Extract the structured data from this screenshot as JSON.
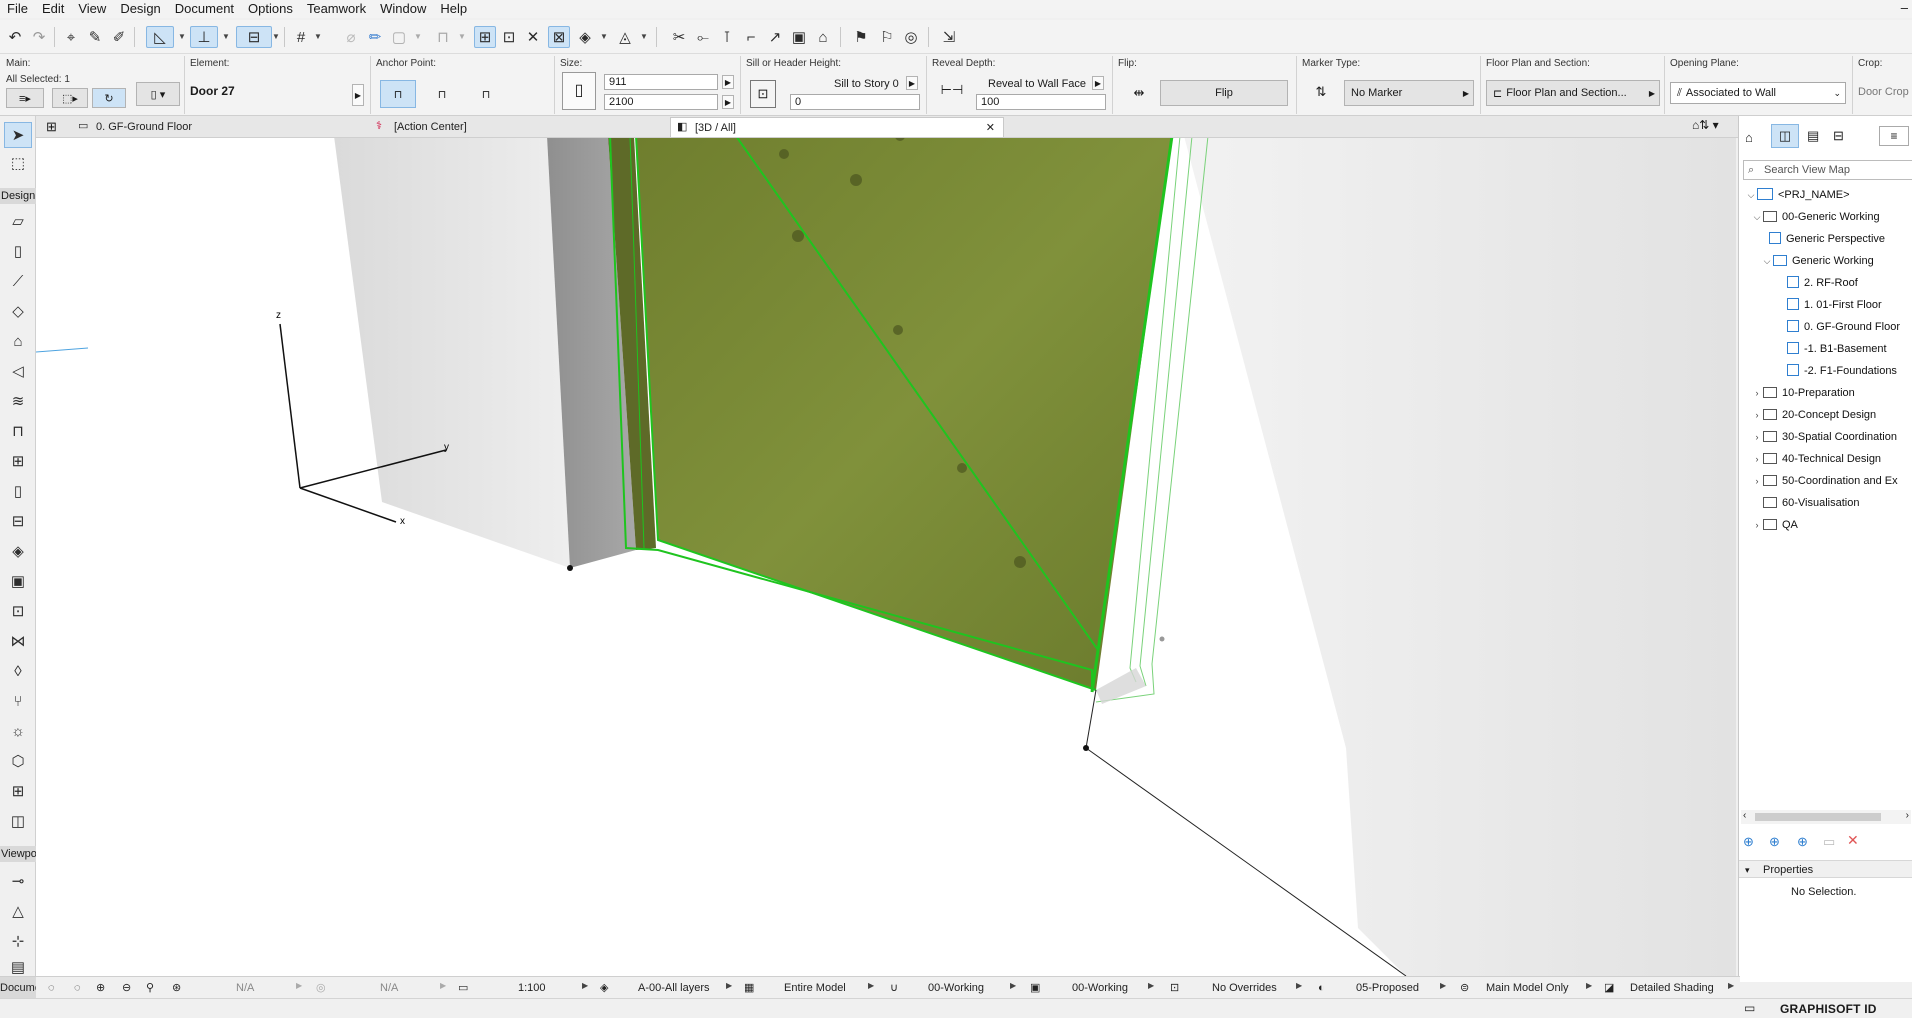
{
  "menu": [
    "File",
    "Edit",
    "View",
    "Design",
    "Document",
    "Options",
    "Teamwork",
    "Window",
    "Help"
  ],
  "infobox": {
    "main_label": "Main:",
    "all_selected": "All Selected: 1",
    "element_label": "Element:",
    "element_name": "Door 27",
    "anchor_label": "Anchor Point:",
    "size_label": "Size:",
    "width": "911",
    "height": "2100",
    "sill_label": "Sill or Header Height:",
    "sill_mode": "Sill to Story 0",
    "sill_value": "0",
    "reveal_label": "Reveal Depth:",
    "reveal_mode": "Reveal to Wall Face",
    "reveal_value": "100",
    "flip_label": "Flip:",
    "flip_button": "Flip",
    "marker_label": "Marker Type:",
    "marker_value": "No Marker",
    "fps_label": "Floor Plan and Section:",
    "fps_value": "Floor Plan and Section...",
    "opening_label": "Opening Plane:",
    "opening_value": "Associated to Wall",
    "crop_label": "Crop:",
    "crop_value": "Door Crop"
  },
  "tabs": [
    {
      "label": "0. GF-Ground Floor"
    },
    {
      "label": "[Action Center]"
    },
    {
      "label": "[3D / All]"
    }
  ],
  "toolbox": {
    "design_header": "Design",
    "viewpoint_header": "Viewpoi",
    "document_header": "Docume"
  },
  "axes": {
    "x": "x",
    "y": "y",
    "z": "z"
  },
  "navigator": {
    "search_placeholder": "Search View Map",
    "root": "<PRJ_NAME>",
    "items": [
      {
        "label": "00-Generic Working"
      },
      {
        "label": "Generic Perspective"
      },
      {
        "label": "Generic Working"
      },
      {
        "label": "2. RF-Roof"
      },
      {
        "label": "1. 01-First Floor"
      },
      {
        "label": "0. GF-Ground Floor"
      },
      {
        "label": "-1. B1-Basement"
      },
      {
        "label": "-2. F1-Foundations"
      },
      {
        "label": "10-Preparation"
      },
      {
        "label": "20-Concept Design"
      },
      {
        "label": "30-Spatial Coordination"
      },
      {
        "label": "40-Technical Design"
      },
      {
        "label": "50-Coordination and Ex"
      },
      {
        "label": "60-Visualisation"
      },
      {
        "label": "QA"
      }
    ],
    "properties_title": "Properties",
    "properties_value": "No Selection."
  },
  "statusbar": {
    "na1": "N/A",
    "na2": "N/A",
    "scale": "1:100",
    "layers": "A-00-All layers",
    "model": "Entire Model",
    "pen1": "00-Working",
    "pen2": "00-Working",
    "overrides": "No Overrides",
    "renovation": "05-Proposed",
    "structure": "Main Model Only",
    "shading": "Detailed Shading"
  },
  "brand": "GRAPHISOFT ID",
  "colors": {
    "accent": "#cde3f6",
    "door_green": "#7a8a33",
    "selection": "#1fc41f"
  }
}
